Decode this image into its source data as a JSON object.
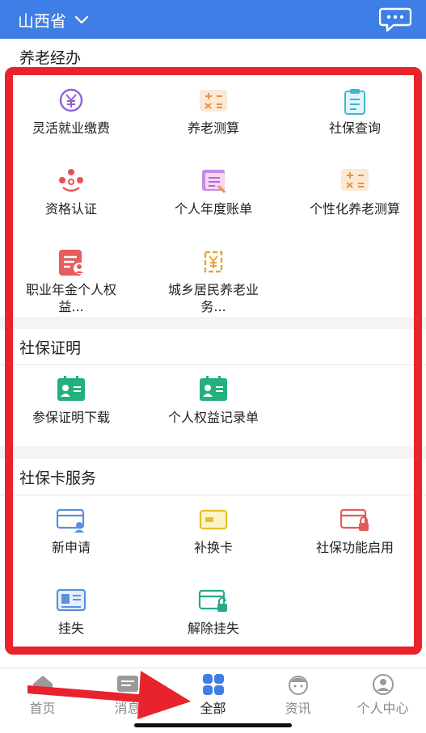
{
  "header": {
    "province": "山西省"
  },
  "sections": [
    {
      "title": "养老经办",
      "items": [
        {
          "label": "灵活就业缴费",
          "icon": "yuan-circle-icon"
        },
        {
          "label": "养老测算",
          "icon": "calculator-icon"
        },
        {
          "label": "社保查询",
          "icon": "clipboard-icon"
        },
        {
          "label": "资格认证",
          "icon": "people-group-icon"
        },
        {
          "label": "个人年度账单",
          "icon": "bill-icon"
        },
        {
          "label": "个性化养老测算",
          "icon": "calculator-icon"
        },
        {
          "label": "职业年金个人权益...",
          "icon": "document-person-icon"
        },
        {
          "label": "城乡居民养老业务...",
          "icon": "yuan-exchange-icon"
        }
      ]
    },
    {
      "title": "社保证明",
      "items": [
        {
          "label": "参保证明下载",
          "icon": "id-card-icon"
        },
        {
          "label": "个人权益记录单",
          "icon": "id-card-icon"
        }
      ]
    },
    {
      "title": "社保卡服务",
      "items": [
        {
          "label": "新申请",
          "icon": "card-person-icon"
        },
        {
          "label": "补换卡",
          "icon": "card-icon"
        },
        {
          "label": "社保功能启用",
          "icon": "card-lock-icon"
        },
        {
          "label": "挂失",
          "icon": "id-card-lines-icon"
        },
        {
          "label": "解除挂失",
          "icon": "card-unlock-icon"
        }
      ]
    }
  ],
  "tabbar": [
    {
      "label": "首页",
      "icon": "home-icon"
    },
    {
      "label": "消息",
      "icon": "message-icon"
    },
    {
      "label": "全部",
      "icon": "grid-icon",
      "active": true
    },
    {
      "label": "资讯",
      "icon": "news-face-icon"
    },
    {
      "label": "个人中心",
      "icon": "user-icon"
    }
  ],
  "colors": {
    "primary": "#3f7ee6",
    "highlight": "#e8232c",
    "arrow": "#e8232c"
  }
}
